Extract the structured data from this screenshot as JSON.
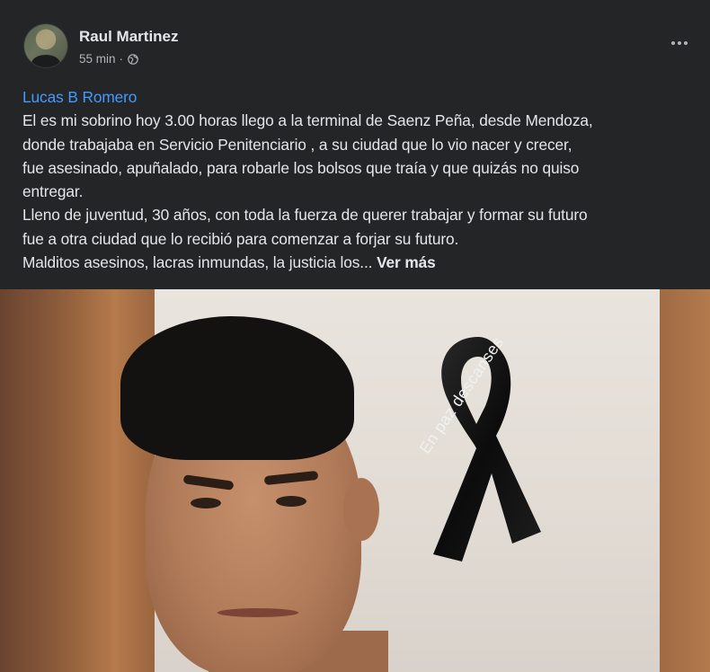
{
  "post": {
    "author": "Raul Martinez",
    "time": "55 min",
    "separator": "·",
    "privacy_icon": "globe-icon",
    "menu_icon": "more-options-icon",
    "mention": "Lucas B Romero",
    "lines": [
      "El es mi sobrino  hoy 3.00 horas llego a la terminal de Saenz Peña, desde Mendoza,",
      "donde trabajaba en Servicio Penitenciario ,  a su ciudad que lo vio nacer y crecer,",
      "fue asesinado, apuñalado, para robarle los bolsos que traía y que quizás no  quiso",
      "entregar.",
      "Lleno de juventud, 30 años, con toda la fuerza de querer trabajar y formar su futuro",
      "fue a otra ciudad que lo recibió para comenzar a forjar su futuro."
    ],
    "last_line": "Malditos asesinos, lacras inmundas, la justicia los...",
    "see_more": "Ver más",
    "photo": {
      "ribbon_text": "En paz descanses"
    }
  },
  "colors": {
    "background": "#242526",
    "text": "#e4e6eb",
    "secondary_text": "#b0b3b8",
    "link": "#4599ff"
  }
}
